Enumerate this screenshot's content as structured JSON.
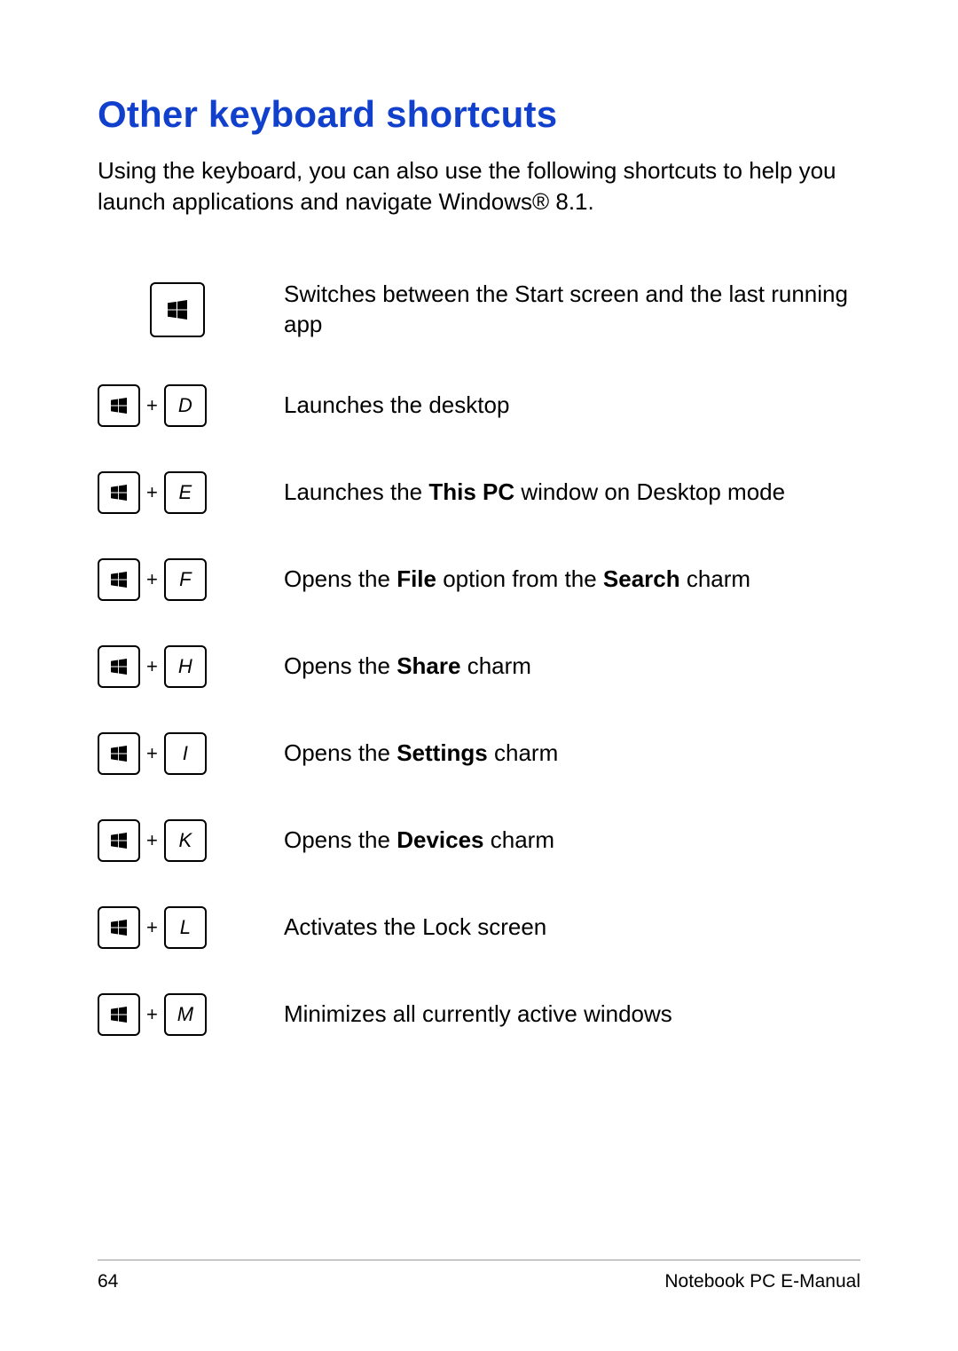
{
  "title": "Other keyboard shortcuts",
  "intro": "Using the keyboard, you can also use the following shortcuts to help you launch applications and navigate Windows® 8.1.",
  "plus": "+",
  "shortcuts": [
    {
      "key2": "",
      "desc": "Switches between the Start screen and the last running app"
    },
    {
      "key2": "D",
      "desc": "Launches the desktop"
    },
    {
      "key2": "E",
      "desc_pre": "Launches the ",
      "bold1": "This PC",
      "desc_post": " window on Desktop mode"
    },
    {
      "key2": "F",
      "desc_pre": "Opens the ",
      "bold1": "File",
      "desc_mid": " option from the ",
      "bold2": "Search",
      "desc_post": " charm"
    },
    {
      "key2": "H",
      "desc_pre": "Opens the ",
      "bold1": "Share",
      "desc_post": " charm"
    },
    {
      "key2": "I",
      "desc_pre": "Opens the ",
      "bold1": "Settings",
      "desc_post": " charm"
    },
    {
      "key2": "K",
      "desc_pre": "Opens the ",
      "bold1": "Devices",
      "desc_post": " charm"
    },
    {
      "key2": "L",
      "desc": "Activates the Lock screen"
    },
    {
      "key2": "M",
      "desc": "Minimizes all currently active windows"
    }
  ],
  "footer": {
    "page_number": "64",
    "doc_title": "Notebook PC E-Manual"
  }
}
